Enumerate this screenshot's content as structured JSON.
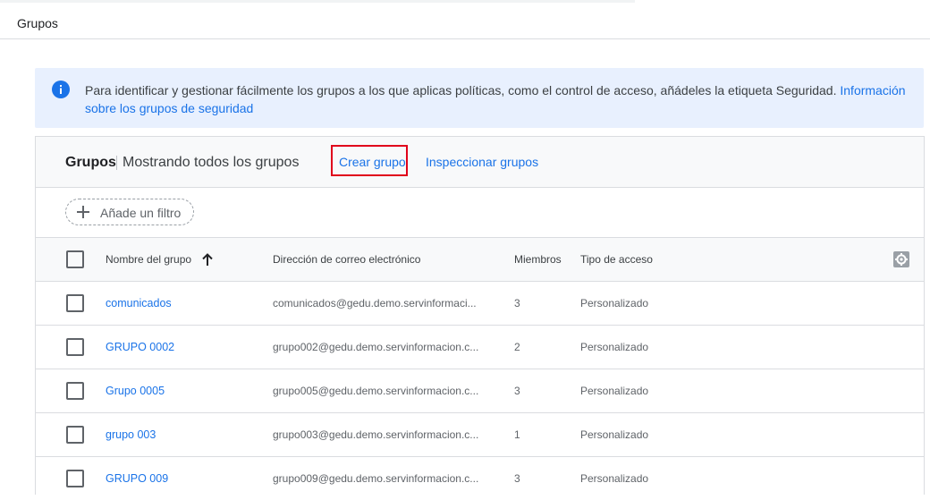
{
  "page": {
    "title": "Grupos"
  },
  "banner": {
    "icon": "info-icon",
    "message": "Para identificar y gestionar fácilmente los grupos a los que aplicas políticas, como el control de acceso, añádeles la etiqueta Seguridad. ",
    "link_text": "Información sobre los grupos de seguridad"
  },
  "toolbar": {
    "title": "Grupos",
    "subtitle": "Mostrando todos los grupos",
    "create_label": "Crear grupo",
    "inspect_label": "Inspeccionar grupos"
  },
  "filter": {
    "label": "Añade un filtro"
  },
  "table": {
    "columns": {
      "name": "Nombre del grupo",
      "email": "Dirección de correo electrónico",
      "members": "Miembros",
      "access": "Tipo de acceso"
    },
    "rows": [
      {
        "name": "comunicados",
        "email": "comunicados@gedu.demo.servinformaci...",
        "members": "3",
        "access": "Personalizado"
      },
      {
        "name": "GRUPO 0002",
        "email": "grupo002@gedu.demo.servinformacion.c...",
        "members": "2",
        "access": "Personalizado"
      },
      {
        "name": "Grupo 0005",
        "email": "grupo005@gedu.demo.servinformacion.c...",
        "members": "3",
        "access": "Personalizado"
      },
      {
        "name": "grupo 003",
        "email": "grupo003@gedu.demo.servinformacion.c...",
        "members": "1",
        "access": "Personalizado"
      },
      {
        "name": "GRUPO 009",
        "email": "grupo009@gedu.demo.servinformacion.c...",
        "members": "3",
        "access": "Personalizado"
      }
    ]
  },
  "colors": {
    "accent": "#1a73e8",
    "banner_bg": "#e8f0fe",
    "highlight": "#e0001b"
  }
}
